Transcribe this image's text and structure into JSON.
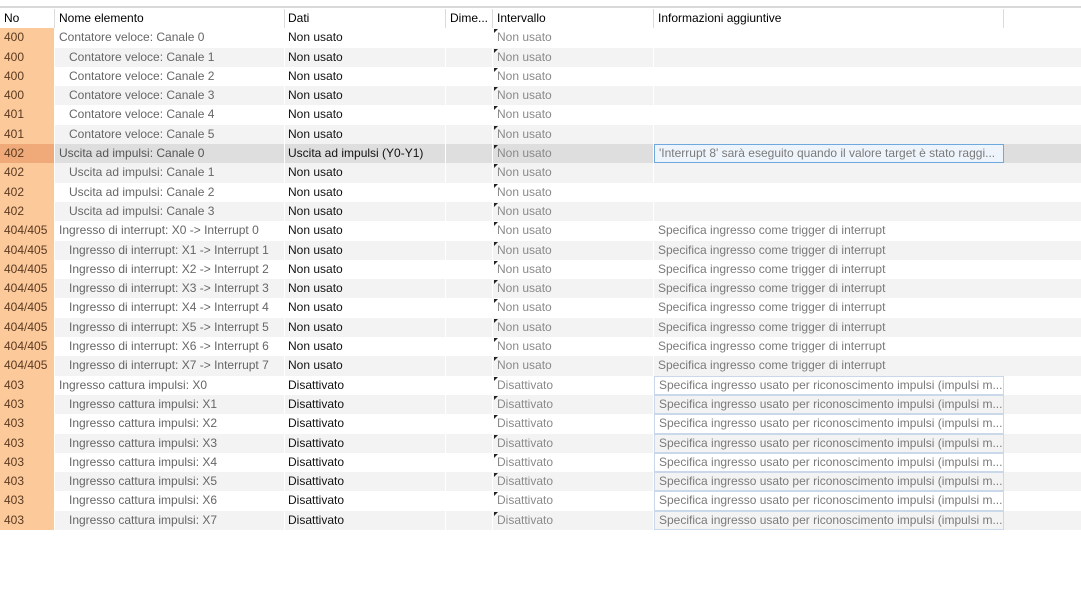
{
  "header": {
    "no": "No",
    "name": "Nome elemento",
    "dati": "Dati",
    "dim": "Dime...",
    "intervallo": "Intervallo",
    "info": "Informazioni aggiuntive"
  },
  "rows": [
    {
      "no": "400",
      "name": "Contatore veloce: Canale 0",
      "dati": "Non usato",
      "dim": "",
      "intervallo": "Non usato",
      "info": ""
    },
    {
      "no": "400",
      "name": "Contatore veloce: Canale 1",
      "dati": "Non usato",
      "dim": "",
      "intervallo": "Non usato",
      "info": ""
    },
    {
      "no": "400",
      "name": "Contatore veloce: Canale 2",
      "dati": "Non usato",
      "dim": "",
      "intervallo": "Non usato",
      "info": ""
    },
    {
      "no": "400",
      "name": "Contatore veloce: Canale 3",
      "dati": "Non usato",
      "dim": "",
      "intervallo": "Non usato",
      "info": ""
    },
    {
      "no": "401",
      "name": "Contatore veloce: Canale 4",
      "dati": "Non usato",
      "dim": "",
      "intervallo": "Non usato",
      "info": ""
    },
    {
      "no": "401",
      "name": "Contatore veloce: Canale 5",
      "dati": "Non usato",
      "dim": "",
      "intervallo": "Non usato",
      "info": ""
    },
    {
      "no": "402",
      "name": "Uscita ad impulsi: Canale 0",
      "dati": "Uscita ad impulsi (Y0-Y1)",
      "dim": "",
      "intervallo": "Non usato",
      "info": "'Interrupt 8' sarà eseguito quando  il valore target è stato raggi..."
    },
    {
      "no": "402",
      "name": "Uscita ad impulsi: Canale 1",
      "dati": "Non usato",
      "dim": "",
      "intervallo": "Non usato",
      "info": ""
    },
    {
      "no": "402",
      "name": "Uscita ad impulsi: Canale 2",
      "dati": "Non usato",
      "dim": "",
      "intervallo": "Non usato",
      "info": ""
    },
    {
      "no": "402",
      "name": "Uscita ad impulsi: Canale 3",
      "dati": "Non usato",
      "dim": "",
      "intervallo": "Non usato",
      "info": ""
    },
    {
      "no": "404/405",
      "name": "Ingresso di interrupt: X0 -> Interrupt 0",
      "dati": "Non usato",
      "dim": "",
      "intervallo": "Non usato",
      "info": "Specifica ingresso come trigger di interrupt"
    },
    {
      "no": "404/405",
      "name": "Ingresso di interrupt: X1 -> Interrupt 1",
      "dati": "Non usato",
      "dim": "",
      "intervallo": "Non usato",
      "info": "Specifica ingresso come trigger di interrupt"
    },
    {
      "no": "404/405",
      "name": "Ingresso di interrupt: X2 -> Interrupt 2",
      "dati": "Non usato",
      "dim": "",
      "intervallo": "Non usato",
      "info": "Specifica ingresso come trigger di interrupt"
    },
    {
      "no": "404/405",
      "name": "Ingresso di interrupt: X3 -> Interrupt 3",
      "dati": "Non usato",
      "dim": "",
      "intervallo": "Non usato",
      "info": "Specifica ingresso come trigger di interrupt"
    },
    {
      "no": "404/405",
      "name": "Ingresso di interrupt: X4 -> Interrupt 4",
      "dati": "Non usato",
      "dim": "",
      "intervallo": "Non usato",
      "info": "Specifica ingresso come trigger di interrupt"
    },
    {
      "no": "404/405",
      "name": "Ingresso di interrupt: X5 -> Interrupt 5",
      "dati": "Non usato",
      "dim": "",
      "intervallo": "Non usato",
      "info": "Specifica ingresso come trigger di interrupt"
    },
    {
      "no": "404/405",
      "name": "Ingresso di interrupt: X6 -> Interrupt 6",
      "dati": "Non usato",
      "dim": "",
      "intervallo": "Non usato",
      "info": "Specifica ingresso come trigger di interrupt"
    },
    {
      "no": "404/405",
      "name": "Ingresso di interrupt: X7 -> Interrupt 7",
      "dati": "Non usato",
      "dim": "",
      "intervallo": "Non usato",
      "info": "Specifica ingresso come trigger di interrupt"
    },
    {
      "no": "403",
      "name": "Ingresso cattura impulsi: X0",
      "dati": "Disattivato",
      "dim": "",
      "intervallo": "Disattivato",
      "info": "Specifica ingresso usato per riconoscimento impulsi (impulsi m..."
    },
    {
      "no": "403",
      "name": "Ingresso cattura impulsi: X1",
      "dati": "Disattivato",
      "dim": "",
      "intervallo": "Disattivato",
      "info": "Specifica ingresso usato per riconoscimento impulsi (impulsi m..."
    },
    {
      "no": "403",
      "name": "Ingresso cattura impulsi: X2",
      "dati": "Disattivato",
      "dim": "",
      "intervallo": "Disattivato",
      "info": "Specifica ingresso usato per riconoscimento impulsi (impulsi m..."
    },
    {
      "no": "403",
      "name": "Ingresso cattura impulsi: X3",
      "dati": "Disattivato",
      "dim": "",
      "intervallo": "Disattivato",
      "info": "Specifica ingresso usato per riconoscimento impulsi (impulsi m..."
    },
    {
      "no": "403",
      "name": "Ingresso cattura impulsi: X4",
      "dati": "Disattivato",
      "dim": "",
      "intervallo": "Disattivato",
      "info": "Specifica ingresso usato per riconoscimento impulsi (impulsi m..."
    },
    {
      "no": "403",
      "name": "Ingresso cattura impulsi: X5",
      "dati": "Disattivato",
      "dim": "",
      "intervallo": "Disattivato",
      "info": "Specifica ingresso usato per riconoscimento impulsi (impulsi m..."
    },
    {
      "no": "403",
      "name": "Ingresso cattura impulsi: X6",
      "dati": "Disattivato",
      "dim": "",
      "intervallo": "Disattivato",
      "info": "Specifica ingresso usato per riconoscimento impulsi (impulsi m..."
    },
    {
      "no": "403",
      "name": "Ingresso cattura impulsi: X7",
      "dati": "Disattivato",
      "dim": "",
      "intervallo": "Disattivato",
      "info": "Specifica ingresso usato per riconoscimento impulsi (impulsi m..."
    }
  ],
  "colors": {
    "no_cell": "#fcc99b",
    "no_cell_selected": "#f0a978",
    "selection_border": "#6fa8dc"
  }
}
